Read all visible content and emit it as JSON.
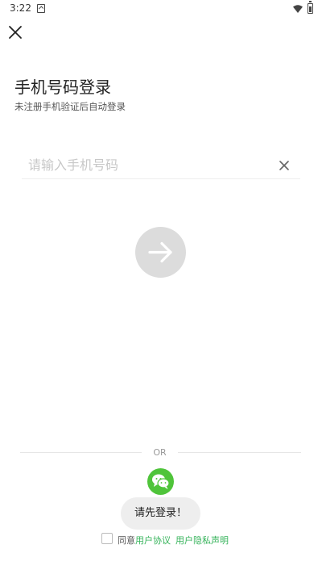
{
  "status_bar": {
    "time": "3:22",
    "icons": [
      "notification-icon",
      "wifi-icon",
      "battery-icon"
    ]
  },
  "login": {
    "title": "手机号码登录",
    "subtitle": "未注册手机验证后自动登录",
    "phone_input": {
      "value": "",
      "placeholder": "请输入手机号码"
    }
  },
  "divider": {
    "text": "OR"
  },
  "toast": {
    "message": "请先登录！"
  },
  "agreement": {
    "prefix": "同意",
    "user_agreement": "用户协议",
    "privacy_policy": "用户隐私声明"
  },
  "colors": {
    "accent_green": "#4fc43a",
    "link_green": "#35b35a",
    "next_button": "#dcdcdc"
  }
}
